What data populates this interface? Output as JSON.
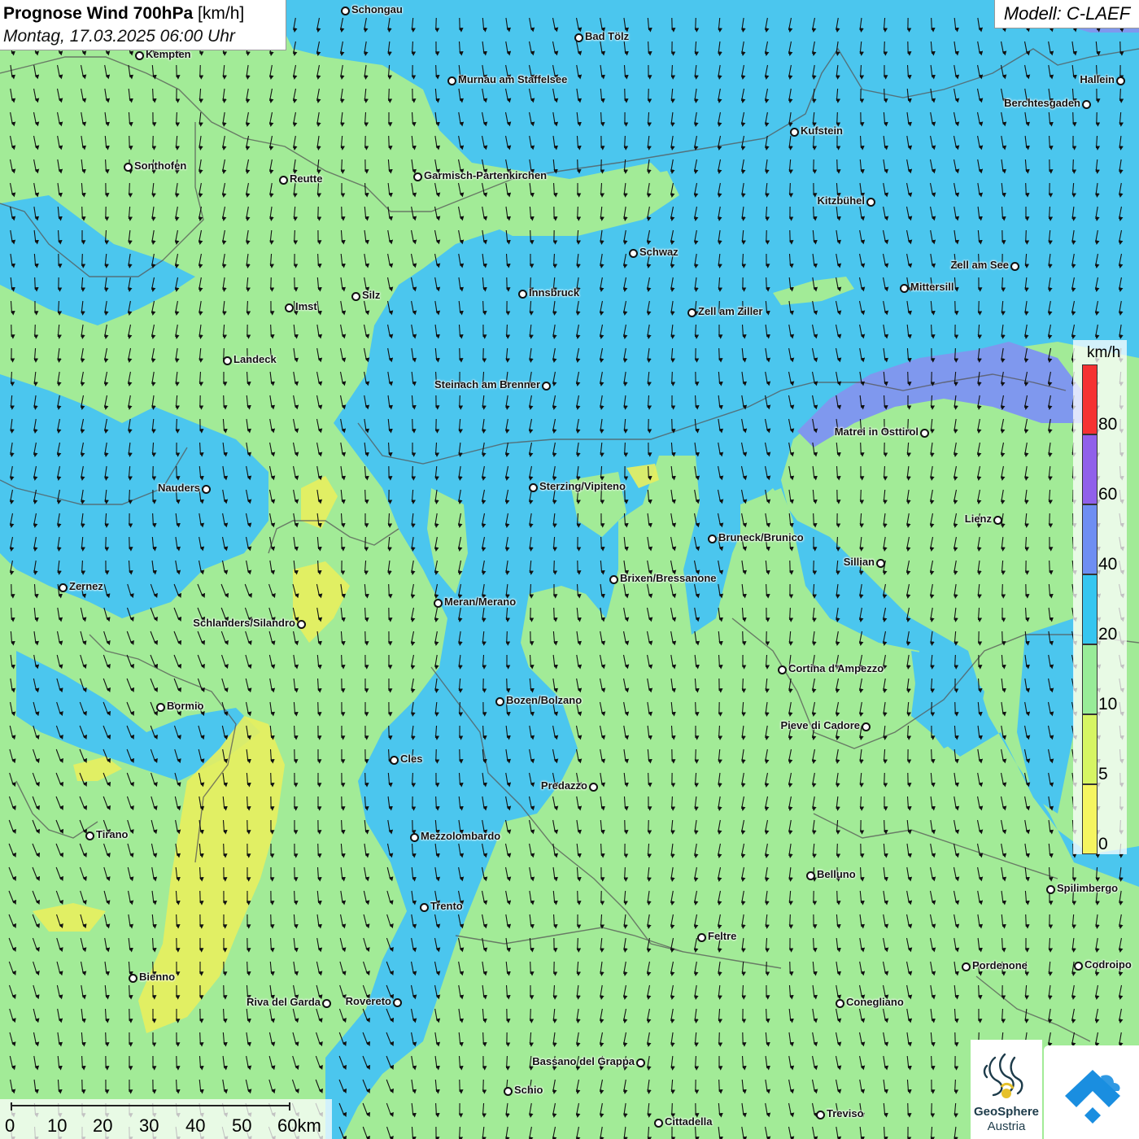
{
  "header": {
    "title_bold": "Prognose Wind 700hPa",
    "title_unit": "[km/h]",
    "datetime": "Montag, 17.03.2025 06:00 Uhr",
    "model": "Modell: C-LAEF"
  },
  "legend": {
    "unit": "km/h",
    "ticks": [
      "0",
      "5",
      "10",
      "20",
      "40",
      "60",
      "80"
    ],
    "colors": [
      "#f5f560",
      "#d6f563",
      "#98ec98",
      "#35c6f0",
      "#6e8ef2",
      "#9060ea",
      "#f53232"
    ]
  },
  "scalebar": {
    "labels": [
      "0",
      "10",
      "20",
      "30",
      "40",
      "50",
      "60km"
    ]
  },
  "logo": {
    "line1": "GeoSphere",
    "line2": "Austria",
    "icon": "geosphere-logo-icon",
    "app_icon": "wind-app-icon"
  },
  "map_colors": {
    "calm": "#f1f163",
    "light": "#a2eb97",
    "moderate": "#4bc6ee",
    "strong": "#7f98ee",
    "arrow": "#111111",
    "border": "#555555"
  },
  "wind_arrows": {
    "direction": "south",
    "icon": "wind-arrow-icon"
  },
  "cities": [
    {
      "name": "Schongau",
      "label_side": "right"
    },
    {
      "name": "Bad Tölz",
      "label_side": "right"
    },
    {
      "name": "Kempten",
      "label_side": "right"
    },
    {
      "name": "Murnau am Staffelsee",
      "label_side": "right"
    },
    {
      "name": "Hallein",
      "label_side": "left"
    },
    {
      "name": "Berchtesgaden",
      "label_side": "left"
    },
    {
      "name": "Kufstein",
      "label_side": "right"
    },
    {
      "name": "Sonthofen",
      "label_side": "right"
    },
    {
      "name": "Reutte",
      "label_side": "right"
    },
    {
      "name": "Garmisch-Partenkirchen",
      "label_side": "right"
    },
    {
      "name": "Kitzbühel",
      "label_side": "left"
    },
    {
      "name": "Schwaz",
      "label_side": "right"
    },
    {
      "name": "Zell am See",
      "label_side": "left"
    },
    {
      "name": "Mittersill",
      "label_side": "right"
    },
    {
      "name": "Innsbruck",
      "label_side": "right"
    },
    {
      "name": "Silz",
      "label_side": "right"
    },
    {
      "name": "Imst",
      "label_side": "right"
    },
    {
      "name": "Zell am Ziller",
      "label_side": "right"
    },
    {
      "name": "Landeck",
      "label_side": "right"
    },
    {
      "name": "Steinach am Brenner",
      "label_side": "left"
    },
    {
      "name": "Matrei in Osttirol",
      "label_side": "left"
    },
    {
      "name": "Nauders",
      "label_side": "left"
    },
    {
      "name": "Sterzing/Vipiteno",
      "label_side": "right"
    },
    {
      "name": "Lienz",
      "label_side": "left"
    },
    {
      "name": "Bruneck/Brunico",
      "label_side": "right"
    },
    {
      "name": "Sillian",
      "label_side": "left"
    },
    {
      "name": "Zernez",
      "label_side": "right"
    },
    {
      "name": "Brixen/Bressanone",
      "label_side": "right"
    },
    {
      "name": "Meran/Merano",
      "label_side": "right"
    },
    {
      "name": "Schlanders/Silandro",
      "label_side": "left"
    },
    {
      "name": "Cortina d'Ampezzo",
      "label_side": "right"
    },
    {
      "name": "Bozen/Bolzano",
      "label_side": "right"
    },
    {
      "name": "Bormio",
      "label_side": "right"
    },
    {
      "name": "Pieve di Cadore",
      "label_side": "left"
    },
    {
      "name": "Cles",
      "label_side": "right"
    },
    {
      "name": "Predazzo",
      "label_side": "left"
    },
    {
      "name": "Tirano",
      "label_side": "right"
    },
    {
      "name": "Mezzolombardo",
      "label_side": "right"
    },
    {
      "name": "Belluno",
      "label_side": "right"
    },
    {
      "name": "Spilimbergo",
      "label_side": "right"
    },
    {
      "name": "Trento",
      "label_side": "right"
    },
    {
      "name": "Feltre",
      "label_side": "right"
    },
    {
      "name": "Pordenone",
      "label_side": "right"
    },
    {
      "name": "Codroipo",
      "label_side": "right"
    },
    {
      "name": "Bienno",
      "label_side": "right"
    },
    {
      "name": "Riva del Garda",
      "label_side": "left"
    },
    {
      "name": "Rovereto",
      "label_side": "left"
    },
    {
      "name": "Conegliano",
      "label_side": "right"
    },
    {
      "name": "Bassano del Grappa",
      "label_side": "left"
    },
    {
      "name": "Schio",
      "label_side": "right"
    },
    {
      "name": "Treviso",
      "label_side": "right"
    },
    {
      "name": "Cittadella",
      "label_side": "right"
    }
  ]
}
